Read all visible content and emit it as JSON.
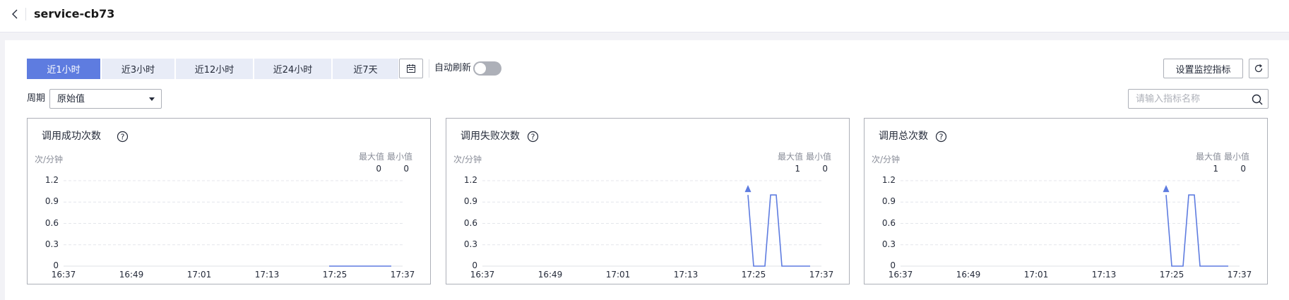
{
  "header": {
    "title": "service-cb73"
  },
  "toolbar": {
    "time_ranges": [
      "近1小时",
      "近3小时",
      "近12小时",
      "近24小时",
      "近7天"
    ],
    "active_time_range": "近1小时",
    "auto_refresh_label": "自动刷新",
    "auto_refresh_on": false,
    "set_metrics_label": "设置监控指标"
  },
  "filter": {
    "period_label": "周期",
    "period_value": "原始值",
    "search_placeholder": "请输入指标名称"
  },
  "colors": {
    "accent": "#5e7ce0",
    "line": "#5e7ce0",
    "toggle_off": "#adb0b8"
  },
  "chart_common": {
    "unit": "次/分钟",
    "max_label": "最大值",
    "min_label": "最小值",
    "x_ticks": [
      "16:37",
      "16:49",
      "17:01",
      "17:13",
      "17:25",
      "17:37"
    ],
    "y_ticks": [
      "1.2",
      "0.9",
      "0.6",
      "0.3",
      "0"
    ]
  },
  "chart_data": [
    {
      "type": "line",
      "title": "调用成功次数",
      "ylabel": "次/分钟",
      "ylim": [
        0,
        1.2
      ],
      "xlim": [
        "16:37",
        "17:37"
      ],
      "grid": true,
      "max": "0",
      "min": "0",
      "series": [
        {
          "x": [
            "17:24",
            "17:25",
            "17:26",
            "17:27",
            "17:28",
            "17:29",
            "17:30",
            "17:31",
            "17:32",
            "17:33",
            "17:34",
            "17:35"
          ],
          "values": [
            0,
            0,
            0,
            0,
            0,
            0,
            0,
            0,
            0,
            0,
            0,
            0
          ]
        }
      ],
      "marker": null
    },
    {
      "type": "line",
      "title": "调用失败次数",
      "ylabel": "次/分钟",
      "ylim": [
        0,
        1.2
      ],
      "xlim": [
        "16:37",
        "17:37"
      ],
      "grid": true,
      "max": "1",
      "min": "0",
      "series": [
        {
          "x": [
            "17:24",
            "17:25",
            "17:26",
            "17:27",
            "17:28",
            "17:29",
            "17:30",
            "17:31",
            "17:32",
            "17:33",
            "17:34",
            "17:35"
          ],
          "values": [
            1,
            0,
            0,
            0,
            1,
            1,
            0,
            0,
            0,
            0,
            0,
            0
          ]
        }
      ],
      "marker": {
        "x": "17:24",
        "value": 1
      }
    },
    {
      "type": "line",
      "title": "调用总次数",
      "ylabel": "次/分钟",
      "ylim": [
        0,
        1.2
      ],
      "xlim": [
        "16:37",
        "17:37"
      ],
      "grid": true,
      "max": "1",
      "min": "0",
      "series": [
        {
          "x": [
            "17:24",
            "17:25",
            "17:26",
            "17:27",
            "17:28",
            "17:29",
            "17:30",
            "17:31",
            "17:32",
            "17:33",
            "17:34",
            "17:35"
          ],
          "values": [
            1,
            0,
            0,
            0,
            1,
            1,
            0,
            0,
            0,
            0,
            0,
            0
          ]
        }
      ],
      "marker": {
        "x": "17:24",
        "value": 1
      }
    }
  ]
}
